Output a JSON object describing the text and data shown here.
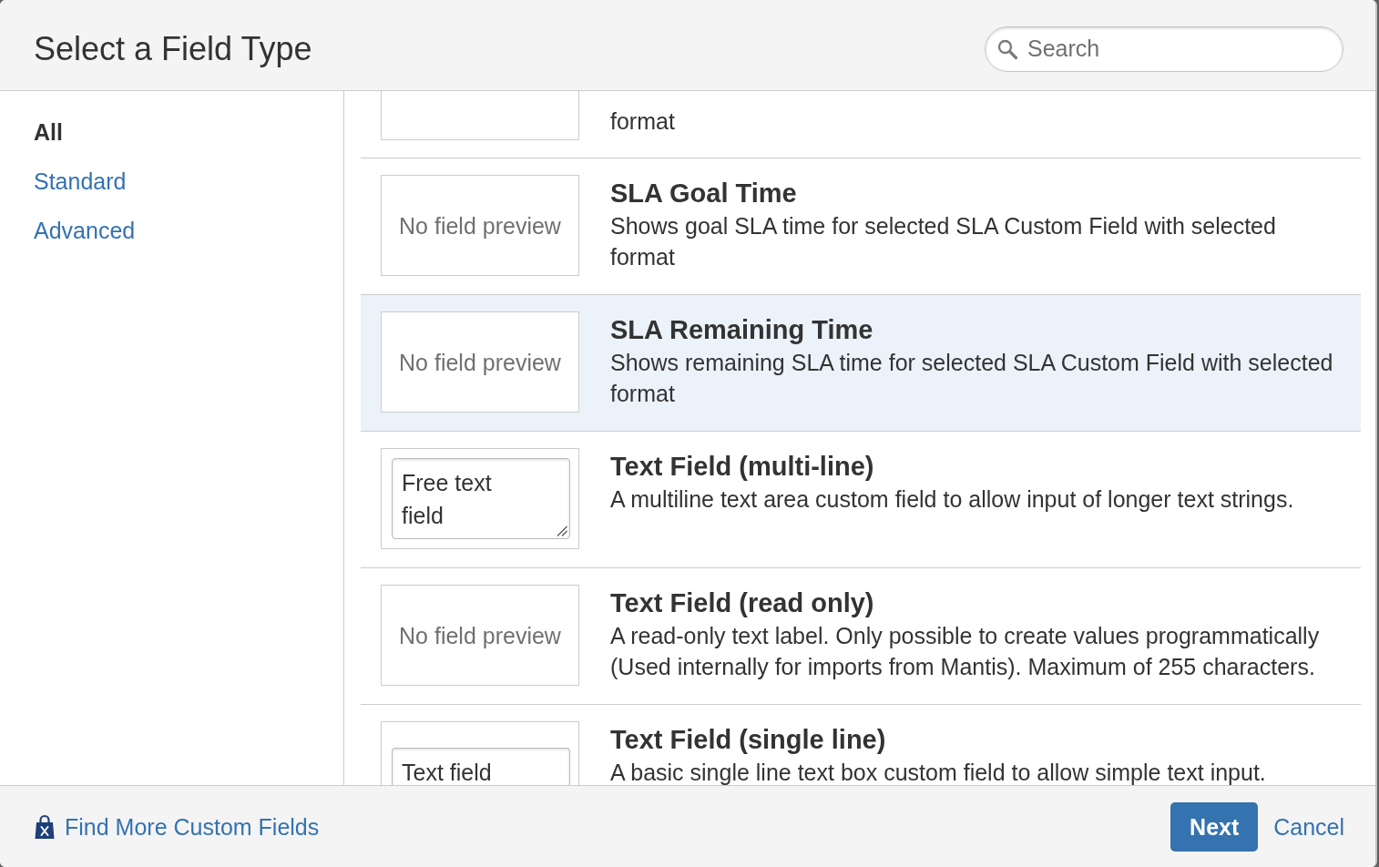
{
  "dialog": {
    "title": "Select a Field Type"
  },
  "search": {
    "placeholder": "Search"
  },
  "sidebar": {
    "items": [
      {
        "label": "All",
        "selected": true
      },
      {
        "label": "Standard",
        "selected": false
      },
      {
        "label": "Advanced",
        "selected": false
      }
    ]
  },
  "field_types": [
    {
      "description": "format",
      "preview": {
        "kind": "none"
      },
      "selected": false
    },
    {
      "title": "SLA Goal Time",
      "description": "Shows goal SLA time for selected SLA Custom Field with selected format",
      "preview": {
        "kind": "none",
        "text": "No field preview"
      },
      "selected": false
    },
    {
      "title": "SLA Remaining Time",
      "description": "Shows remaining SLA time for selected SLA Custom Field with selected format",
      "preview": {
        "kind": "none",
        "text": "No field preview"
      },
      "selected": true
    },
    {
      "title": "Text Field (multi-line)",
      "description": "A multiline text area custom field to allow input of longer text strings.",
      "preview": {
        "kind": "textarea",
        "value": "Free text field"
      },
      "selected": false
    },
    {
      "title": "Text Field (read only)",
      "description": "A read-only text label. Only possible to create values programmatically (Used internally for imports from Mantis). Maximum of 255 characters.",
      "preview": {
        "kind": "none",
        "text": "No field preview"
      },
      "selected": false
    },
    {
      "title": "Text Field (single line)",
      "description": "A basic single line text box custom field to allow simple text input.",
      "preview": {
        "kind": "input",
        "value": "Text field"
      },
      "selected": false
    }
  ],
  "footer": {
    "link": "Find More Custom Fields",
    "buttons": [
      {
        "kind": "primary",
        "label": "Next"
      },
      {
        "kind": "link",
        "label": "Cancel"
      }
    ]
  }
}
